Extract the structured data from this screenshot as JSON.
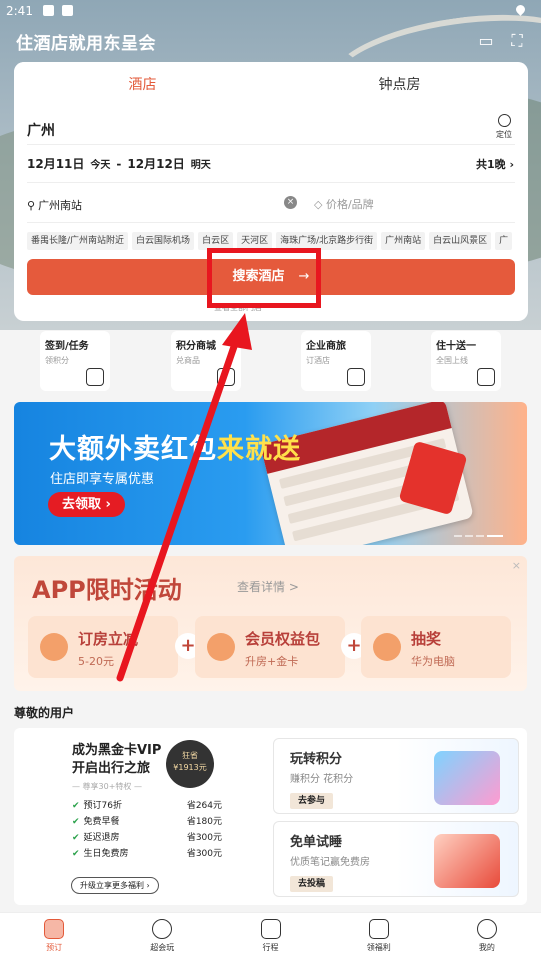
{
  "status": {
    "time": "2:41"
  },
  "header": {
    "title": "住酒店就用东呈会"
  },
  "booking": {
    "tabs": [
      {
        "label": "酒店"
      },
      {
        "label": "钟点房"
      }
    ],
    "city": "广州",
    "locate_label": "定位",
    "checkin": "12月11日",
    "checkin_day": "今天",
    "separator": "-",
    "checkout": "12月12日",
    "checkout_day": "明天",
    "nights": "共1晚 ›",
    "keyword": "广州南站",
    "price_placeholder": "价格/品牌",
    "chips": [
      "番禺长隆/广州南站附近",
      "白云国际机场",
      "白云区",
      "天河区",
      "海珠广场/北京路步行街",
      "广州南站",
      "白云山风景区",
      "广"
    ],
    "search_label": "搜索酒店",
    "search_arrow": "→",
    "hint": "查看全部门店"
  },
  "quick": [
    {
      "title": "签到/任务",
      "sub": "领积分"
    },
    {
      "title": "积分商城",
      "sub": "兑商品"
    },
    {
      "title": "企业商旅",
      "sub": "订酒店"
    },
    {
      "title": "住十送一",
      "sub": "全国上线"
    }
  ],
  "banner": {
    "headline_a": "大额外卖红包",
    "headline_b": "来就送",
    "sub": "住店即享专属优惠",
    "cta": "去领取 ›"
  },
  "promo": {
    "title": "APP限时活动",
    "more": "查看详情 >",
    "close": "×",
    "items": [
      {
        "l1": "订房立减",
        "l2": "5-20元"
      },
      {
        "l1": "会员权益包",
        "l2": "升房+金卡"
      },
      {
        "l1": "抽奖",
        "l2": "华为电脑"
      }
    ],
    "plus": "+"
  },
  "members": {
    "section": "尊敬的用户",
    "vip_line1": "成为黑金卡VIP",
    "vip_line2": "开启出行之旅",
    "vip_sub": "— 尊享30+特权 —",
    "medal_top": "狂省",
    "medal_val": "¥1913元",
    "benefits": [
      {
        "name": "预订76折",
        "save": "省264元"
      },
      {
        "name": "免费早餐",
        "save": "省180元"
      },
      {
        "name": "延迟退房",
        "save": "省300元"
      },
      {
        "name": "生日免费房",
        "save": "省300元"
      }
    ],
    "upgrade": "升级立享更多福利 ›",
    "tiles": [
      {
        "title": "玩转积分",
        "sub": "赚积分 花积分",
        "btn": "去参与"
      },
      {
        "title": "免单试睡",
        "sub": "优质笔记赢免费房",
        "btn": "去投稿"
      }
    ]
  },
  "nav": [
    {
      "label": "预订"
    },
    {
      "label": "超会玩"
    },
    {
      "label": "行程"
    },
    {
      "label": "领福利"
    },
    {
      "label": "我的"
    }
  ],
  "colors": {
    "accent": "#e55a3c",
    "annotation": "#e8161f"
  }
}
